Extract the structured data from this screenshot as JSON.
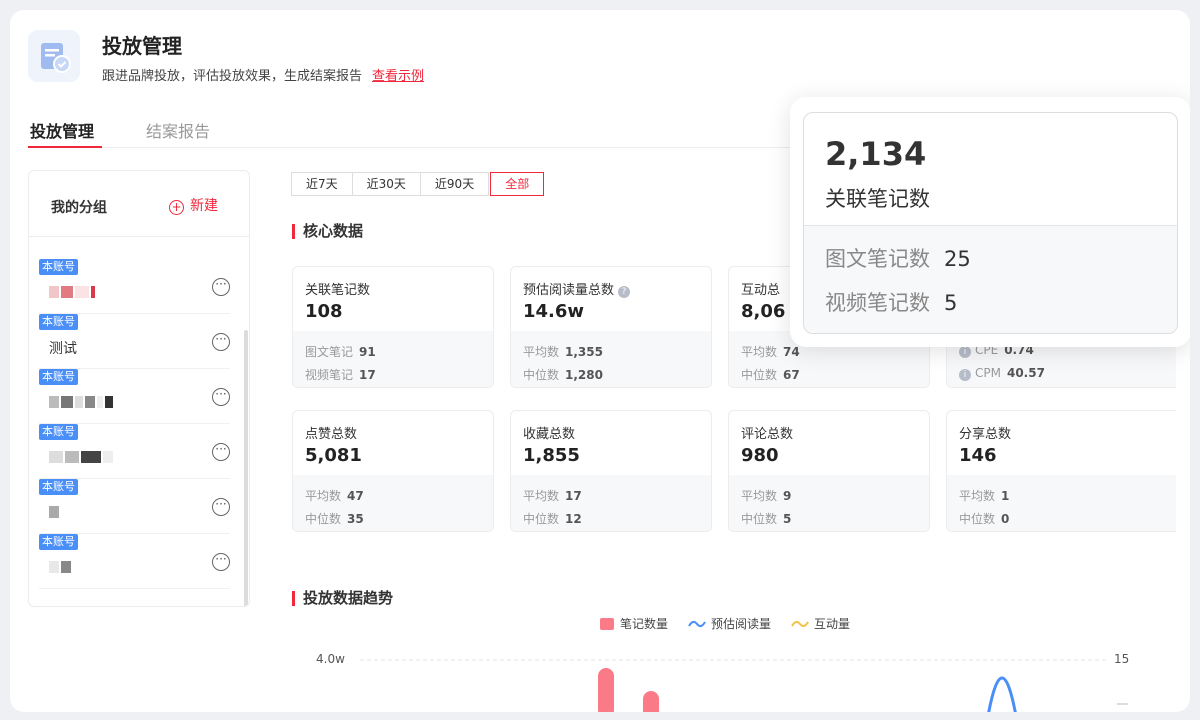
{
  "header": {
    "title": "投放管理",
    "subtitle": "跟进品牌投放，评估投放效果，生成结案报告",
    "example_link": "查看示例"
  },
  "tabs": [
    {
      "label": "投放管理",
      "active": true
    },
    {
      "label": "结案报告",
      "active": false
    }
  ],
  "sidebar": {
    "title": "我的分组",
    "new_label": "新建",
    "items": [
      {
        "badge": "本账号",
        "name": ""
      },
      {
        "badge": "本账号",
        "name": "测试"
      },
      {
        "badge": "本账号",
        "name": ""
      },
      {
        "badge": "本账号",
        "name": ""
      },
      {
        "badge": "本账号",
        "name": ""
      },
      {
        "badge": "本账号",
        "name": ""
      }
    ]
  },
  "filters": [
    {
      "label": "近7天",
      "active": false
    },
    {
      "label": "近30天",
      "active": false
    },
    {
      "label": "近90天",
      "active": false
    },
    {
      "label": "全部",
      "active": true
    }
  ],
  "core_title": "核心数据",
  "cards": [
    {
      "label": "关联笔记数",
      "value": "108",
      "rows": [
        {
          "k": "图文笔记",
          "v": "91"
        },
        {
          "k": "视频笔记",
          "v": "17"
        }
      ]
    },
    {
      "label": "预估阅读量总数",
      "value": "14.6w",
      "rows": [
        {
          "k": "平均数",
          "v": "1,355"
        },
        {
          "k": "中位数",
          "v": "1,280"
        }
      ]
    },
    {
      "label": "互动总",
      "value": "8,06",
      "rows": [
        {
          "k": "平均数",
          "v": "74"
        },
        {
          "k": "中位数",
          "v": "67"
        }
      ]
    },
    {
      "label": "",
      "value": "",
      "rows": [
        {
          "k": "CPE",
          "v": "0.74"
        },
        {
          "k": "CPM",
          "v": "40.57"
        }
      ]
    },
    {
      "label": "点赞总数",
      "value": "5,081",
      "rows": [
        {
          "k": "平均数",
          "v": "47"
        },
        {
          "k": "中位数",
          "v": "35"
        }
      ]
    },
    {
      "label": "收藏总数",
      "value": "1,855",
      "rows": [
        {
          "k": "平均数",
          "v": "17"
        },
        {
          "k": "中位数",
          "v": "12"
        }
      ]
    },
    {
      "label": "评论总数",
      "value": "980",
      "rows": [
        {
          "k": "平均数",
          "v": "9"
        },
        {
          "k": "中位数",
          "v": "5"
        }
      ]
    },
    {
      "label": "分享总数",
      "value": "146",
      "rows": [
        {
          "k": "平均数",
          "v": "1"
        },
        {
          "k": "中位数",
          "v": "0"
        }
      ]
    }
  ],
  "trend_title": "投放数据趋势",
  "legend": [
    "笔记数量",
    "预估阅读量",
    "互动量"
  ],
  "axis": {
    "left_top": "4.0w",
    "right_top": "15"
  },
  "popup": {
    "total": "2,134",
    "total_label": "关联笔记数",
    "rows": [
      {
        "k": "图文笔记数",
        "v": "25"
      },
      {
        "k": "视频笔记数",
        "v": "5"
      }
    ]
  },
  "colors": {
    "accent": "#f0283c",
    "badge": "#4a8ff7",
    "bar": "#fb7a87",
    "read_line": "#4a8ff7",
    "interact_line": "#f5c14a"
  }
}
